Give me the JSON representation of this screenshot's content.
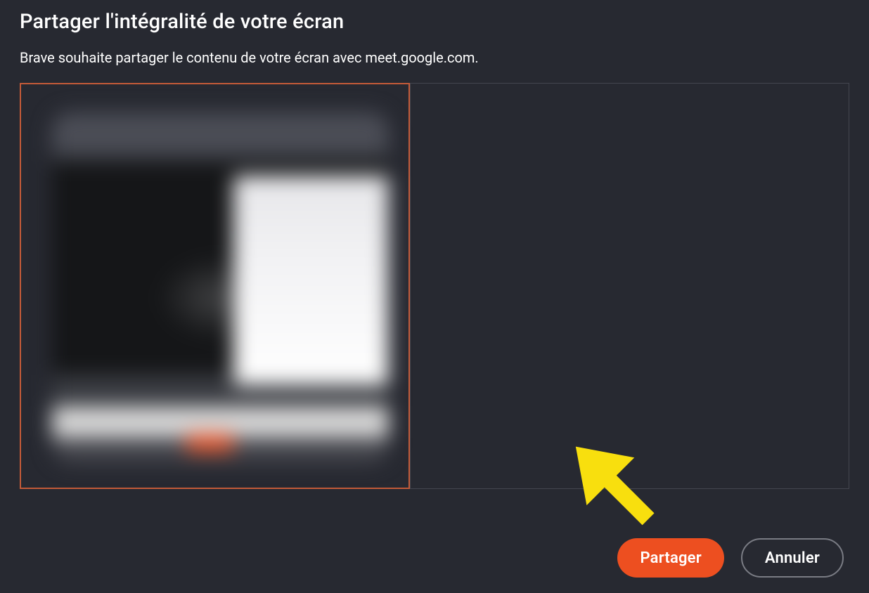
{
  "dialog": {
    "title": "Partager l'intégralité de votre écran",
    "subtitle": "Brave souhaite partager le contenu de votre écran avec meet.google.com."
  },
  "buttons": {
    "share": "Partager",
    "cancel": "Annuler"
  },
  "colors": {
    "accent": "#ed4f20",
    "selected_border": "#c35a38",
    "pointer": "#f8df0e"
  }
}
